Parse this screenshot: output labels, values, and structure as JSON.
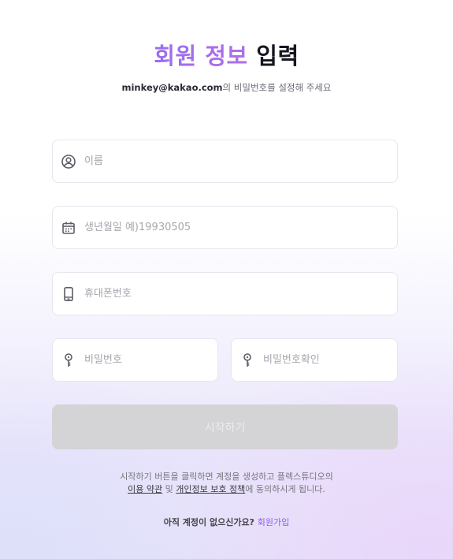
{
  "header": {
    "title_accent": "회원 정보",
    "title_rest": "입력",
    "email": "minkey@kakao.com",
    "subtitle_suffix": "의 비밀번호를 설정해 주세요"
  },
  "form": {
    "name": {
      "placeholder": "이름",
      "icon": "user-circle-icon"
    },
    "birthdate": {
      "placeholder": "생년월일 예)19930505",
      "icon": "calendar-icon"
    },
    "phone": {
      "placeholder": "휴대폰번호",
      "icon": "phone-icon"
    },
    "password": {
      "placeholder": "비밀번호",
      "icon": "key-icon"
    },
    "password_confirm": {
      "placeholder": "비밀번호확인",
      "icon": "key-icon"
    },
    "submit_label": "시작하기"
  },
  "terms": {
    "line1": "시작하기 버튼을 클릭하면 계정을 생성하고 플렉스튜디오의",
    "terms_link": "이용 약관",
    "and": " 및 ",
    "privacy_link": "개인정보 보호 정책",
    "line2_suffix": "에 동의하시게 됩니다."
  },
  "signup": {
    "prompt": "아직 계정이 없으신가요?",
    "link": "회원가입"
  },
  "colors": {
    "accent": "#9a6cf0",
    "link": "#8b5ef0",
    "button_disabled": "#d4d4d6"
  }
}
